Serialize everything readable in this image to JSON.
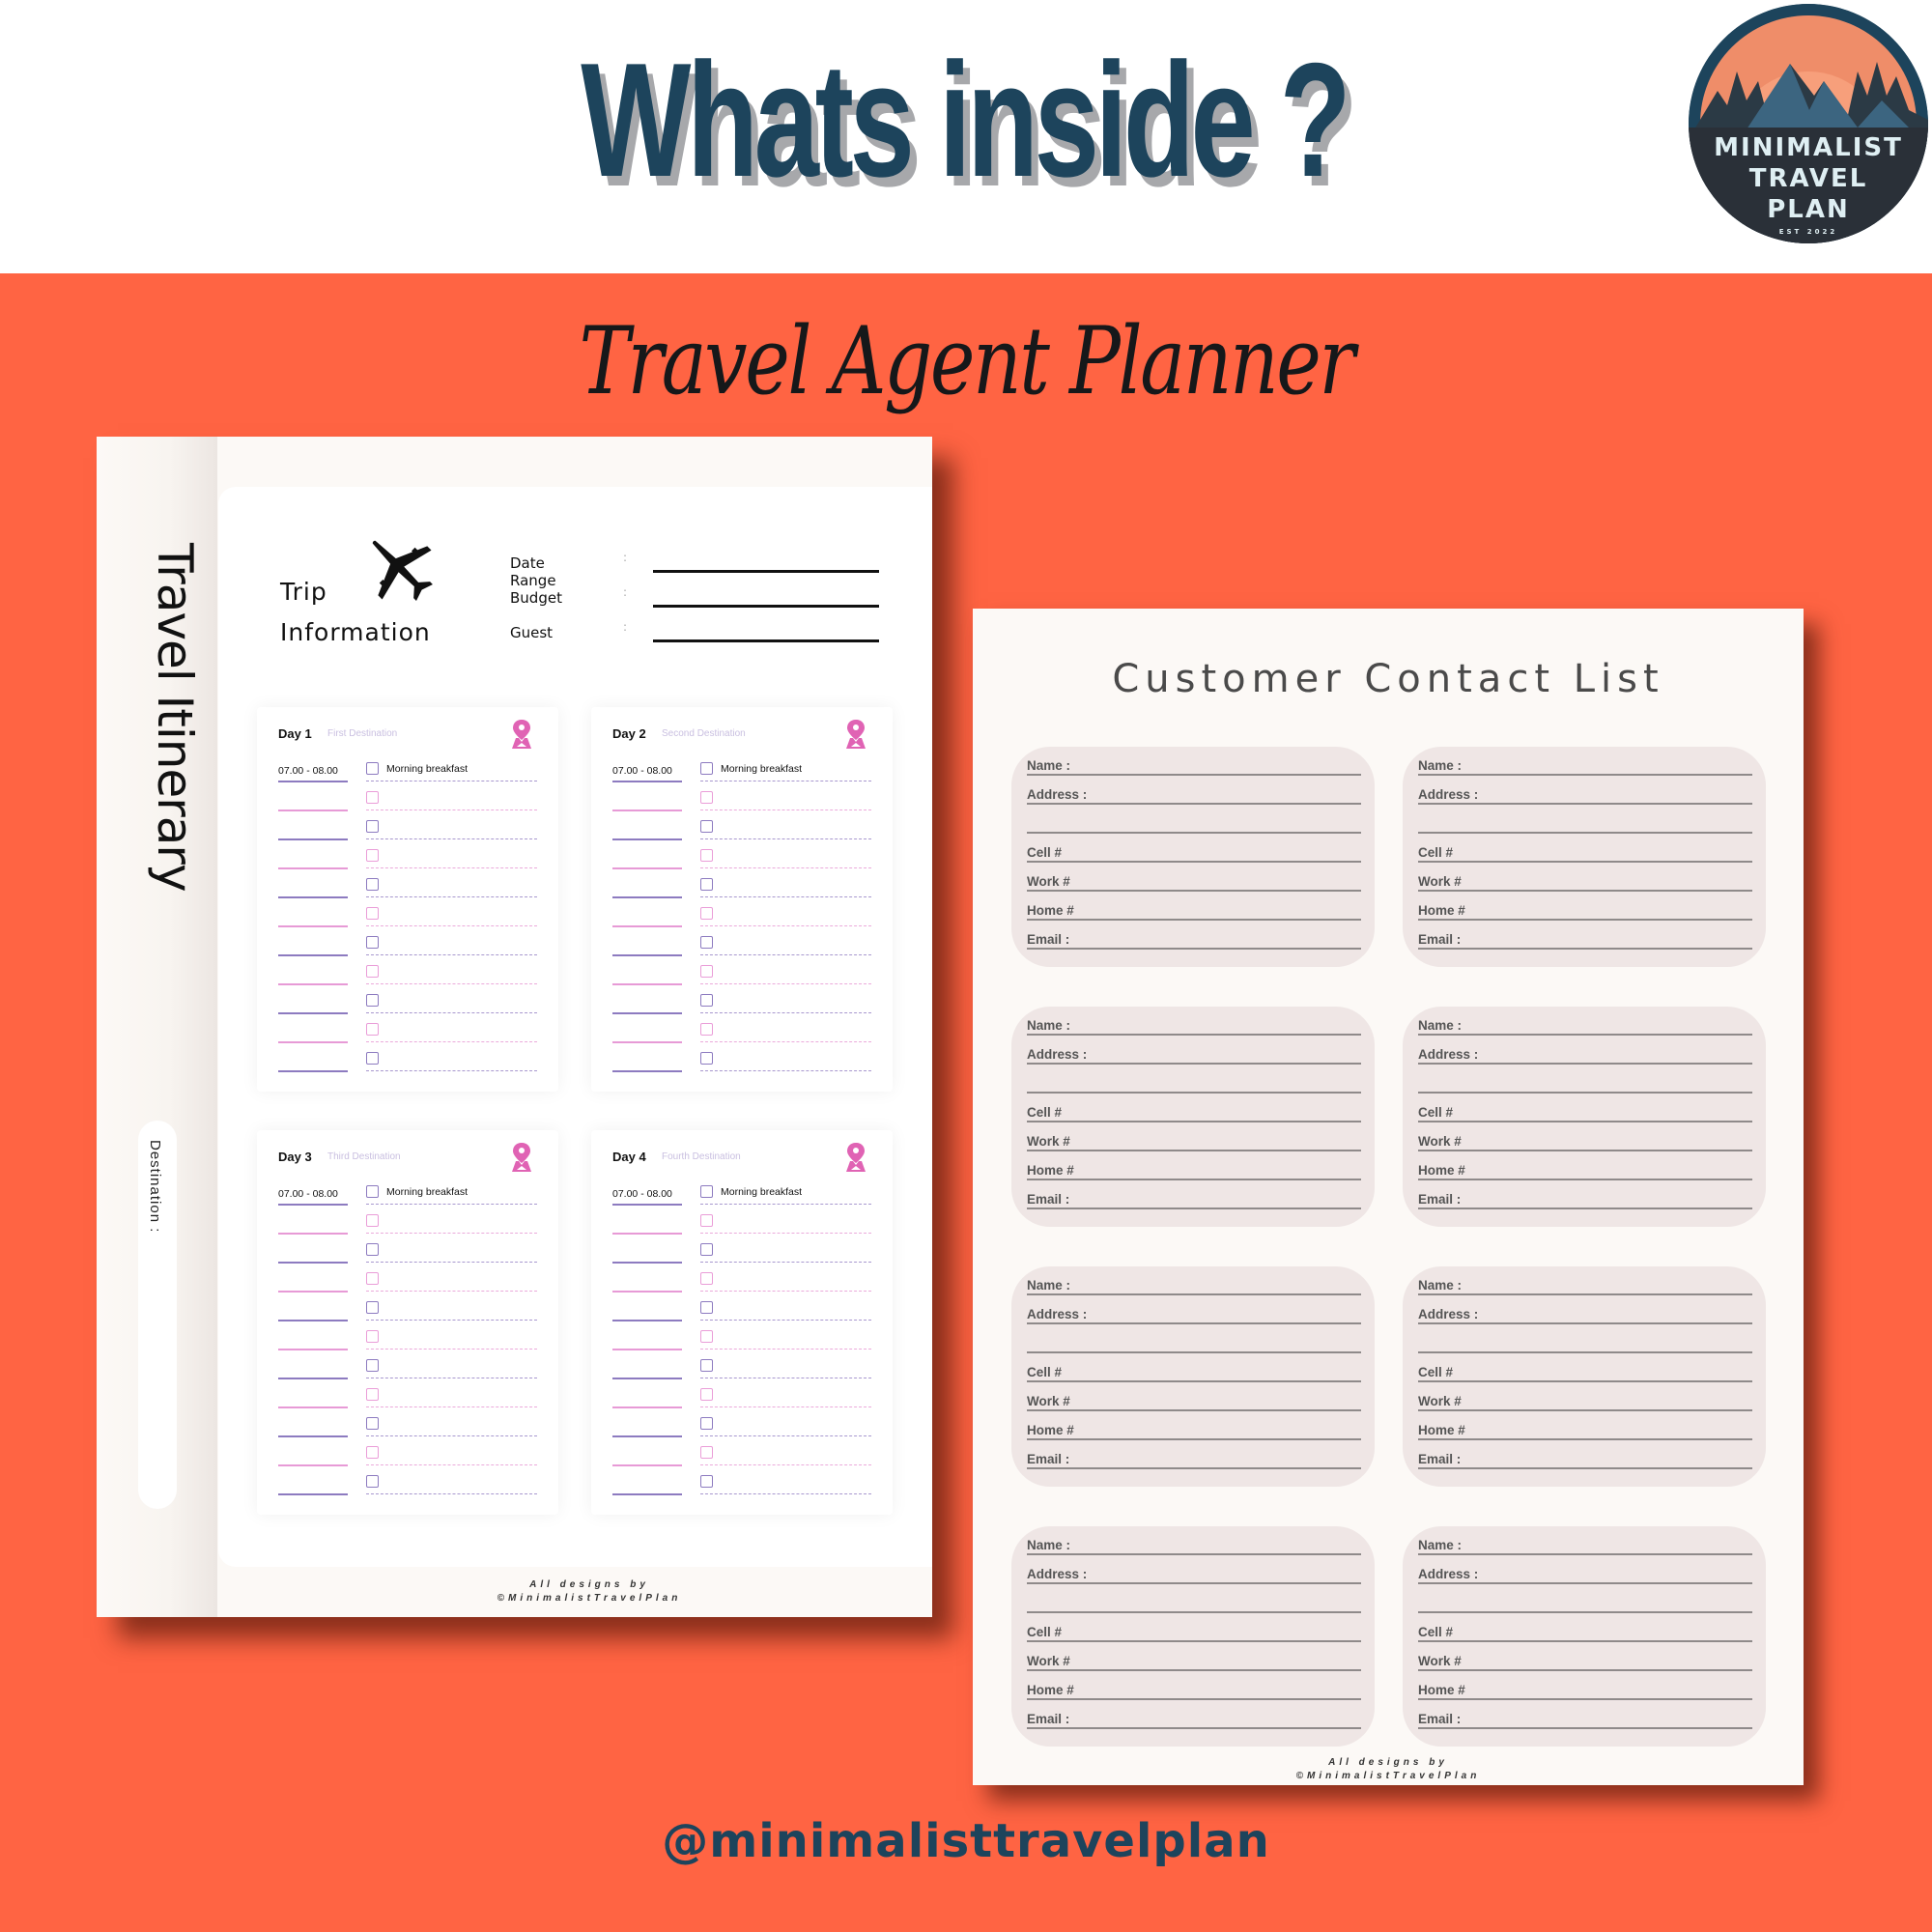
{
  "header": {
    "title": "Whats inside ?",
    "logo": {
      "line1": "MINIMALIST",
      "line2": "TRAVEL",
      "line3": "PLAN",
      "est": "EST 2022",
      "icon": "mountain-sunset-logo"
    }
  },
  "subtitle": "Travel Agent Planner",
  "itinerary_page": {
    "side_title": "Travel Itinerary",
    "destination_label": "Destination :",
    "trip_info": {
      "title_line1": "Trip",
      "title_line2": "Information",
      "icon": "airplane-icon",
      "fields": [
        {
          "label": "Date Range",
          "colon": ":",
          "value": ""
        },
        {
          "label": "Budget",
          "colon": ":",
          "value": ""
        },
        {
          "label": "Guest",
          "colon": ":",
          "value": ""
        }
      ]
    },
    "days": [
      {
        "label": "Day 1",
        "destination": "First Destination",
        "first_time": "07.00 - 08.00",
        "first_activity": "Morning breakfast"
      },
      {
        "label": "Day 2",
        "destination": "Second Destination",
        "first_time": "07.00 - 08.00",
        "first_activity": "Morning breakfast"
      },
      {
        "label": "Day 3",
        "destination": "Third Destination",
        "first_time": "07.00 - 08.00",
        "first_activity": "Morning breakfast"
      },
      {
        "label": "Day 4",
        "destination": "Fourth Destination",
        "first_time": "07.00 - 08.00",
        "first_activity": "Morning breakfast"
      }
    ],
    "rows_per_day": 11,
    "credit_line1": "All designs by",
    "credit_line2": "©MinimalistTravelPlan"
  },
  "contact_page": {
    "title": "Customer Contact List",
    "field_labels": {
      "name": "Name :",
      "address": "Address :",
      "cell": "Cell #",
      "work": "Work #",
      "home": "Home #",
      "email": "Email :"
    },
    "card_count": 8,
    "credit_line1": "All designs by",
    "credit_line2": "©MinimalistTravelPlan"
  },
  "footer": {
    "handle": "@minimalisttravelplan"
  },
  "colors": {
    "background": "#ff6443",
    "navy": "#1d445c",
    "pink_accent": "#e063b4",
    "purple_line": "#8d7bc0",
    "pink_line": "#e79ad6",
    "contact_card": "#efe6e5",
    "page": "#fcf9f6"
  }
}
